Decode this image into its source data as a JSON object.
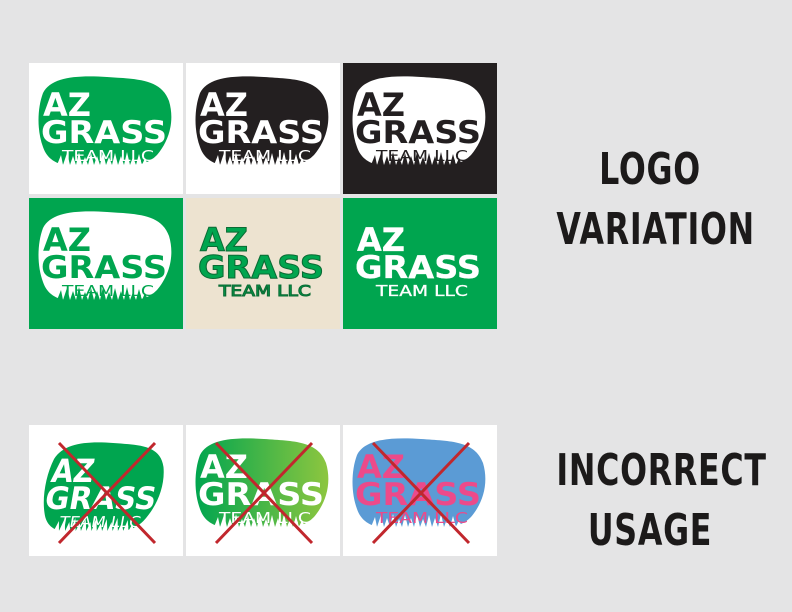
{
  "logo": {
    "line1": "AZ",
    "line2": "GRASS",
    "line3": "TEAM LLC"
  },
  "headings": {
    "variation_line1": "LOGO",
    "variation_line2": "VARIATION",
    "incorrect_line1": "INCORRECT",
    "incorrect_line2": "USAGE"
  },
  "colors": {
    "page_bg": "#e4e4e5",
    "brand_green": "#00a54f",
    "black": "#231f20",
    "tan": "#ede3d0",
    "white": "#ffffff",
    "light_green": "#8dc63f",
    "pink": "#ec4a8a",
    "blue": "#5b9bd5",
    "red_cross": "#c1272d"
  },
  "variations": [
    {
      "name": "green-blob-white-bg",
      "bg": "#ffffff",
      "blob": "#00a54f",
      "text": "#ffffff"
    },
    {
      "name": "black-blob-white-bg",
      "bg": "#ffffff",
      "blob": "#231f20",
      "text": "#ffffff"
    },
    {
      "name": "white-blob-black-bg",
      "bg": "#231f20",
      "blob": "#ffffff",
      "text": "#231f20"
    },
    {
      "name": "white-blob-green-bg",
      "bg": "#00a54f",
      "blob": "#ffffff",
      "text": "#00a54f"
    },
    {
      "name": "no-blob-tan-bg",
      "bg": "#ede3d0",
      "blob": "none",
      "text": "#00a54f"
    },
    {
      "name": "no-blob-green-bg",
      "bg": "#00a54f",
      "blob": "none",
      "text": "#ffffff"
    }
  ],
  "incorrect": [
    {
      "name": "distorted",
      "bg": "#ffffff",
      "blob": "#00a54f",
      "text": "#ffffff"
    },
    {
      "name": "gradient",
      "bg": "#ffffff",
      "blob": "gradient",
      "text": "#ffffff"
    },
    {
      "name": "wrong-colors",
      "bg": "#ffffff",
      "blob": "#5b9bd5",
      "text": "#ec4a8a"
    }
  ]
}
